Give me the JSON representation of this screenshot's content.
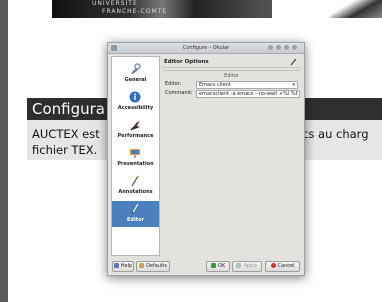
{
  "background_slide": {
    "image_text_1": "UNIVERSITÉ",
    "image_text_2": "FRANCHE-COMTÉ",
    "title": "Configura",
    "body_line1_left": "AUCTEX est",
    "body_line1_right": "acs au charg",
    "body_line2": "fichier TEX."
  },
  "dialog": {
    "window_title": "Configure – Okular",
    "sidebar": [
      {
        "label": "General",
        "icon": "general-icon"
      },
      {
        "label": "Accessibility",
        "icon": "accessibility-icon"
      },
      {
        "label": "Performance",
        "icon": "performance-icon"
      },
      {
        "label": "Presentation",
        "icon": "presentation-icon"
      },
      {
        "label": "Annotations",
        "icon": "annotations-icon"
      },
      {
        "label": "Editor",
        "icon": "editor-icon",
        "active": true
      }
    ],
    "page_header": "Editor Options",
    "group_title": "Editor",
    "editor_label": "Editor:",
    "editor_value": "Emacs client",
    "command_label": "Command:",
    "command_value": "emacsclient -a emacs --no-wait +%l %f",
    "buttons": {
      "help": "Help",
      "defaults": "Defaults",
      "ok": "OK",
      "apply": "Apply",
      "cancel": "Cancel"
    }
  },
  "colors": {
    "active_sidebar": "#4a7fc0",
    "slide_title_bg": "#2f2f2f",
    "slide_body_bg": "#e6e6e6"
  }
}
